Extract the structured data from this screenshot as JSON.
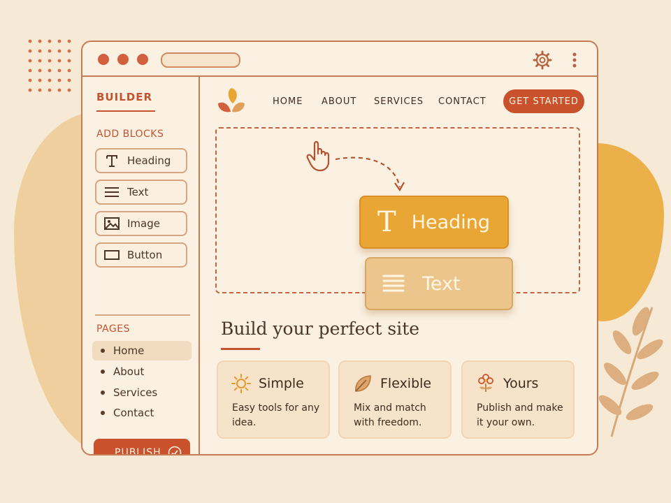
{
  "sidebar": {
    "brand": "BUILDER",
    "add_blocks_title": "ADD BLOCKS",
    "blocks": [
      {
        "label": "Heading",
        "icon": "heading-icon"
      },
      {
        "label": "Text",
        "icon": "text-lines-icon"
      },
      {
        "label": "Image",
        "icon": "image-icon"
      },
      {
        "label": "Button",
        "icon": "button-icon"
      }
    ],
    "pages_title": "PAGES",
    "pages": [
      {
        "label": "Home",
        "active": true
      },
      {
        "label": "About",
        "active": false
      },
      {
        "label": "Services",
        "active": false
      },
      {
        "label": "Contact",
        "active": false
      }
    ],
    "publish_label": "PUBLISH"
  },
  "nav": {
    "links": [
      "HOME",
      "ABOUT",
      "SERVICES",
      "CONTACT"
    ],
    "cta_label": "GET STARTED"
  },
  "canvas": {
    "dragged_heading_label": "Heading",
    "dragged_text_label": "Text"
  },
  "hero": {
    "title": "Build your perfect site"
  },
  "cards": [
    {
      "title": "Simple",
      "desc": "Easy tools for any idea.",
      "icon": "sun-icon"
    },
    {
      "title": "Flexible",
      "desc": "Mix and match with freedom.",
      "icon": "leaf-icon"
    },
    {
      "title": "Yours",
      "desc": "Publish and make it your own.",
      "icon": "flower-icon"
    }
  ],
  "colors": {
    "accent": "#c9512c",
    "heading_block": "#e9a634",
    "text_block": "#ecc58c",
    "background": "#f6ead6"
  }
}
